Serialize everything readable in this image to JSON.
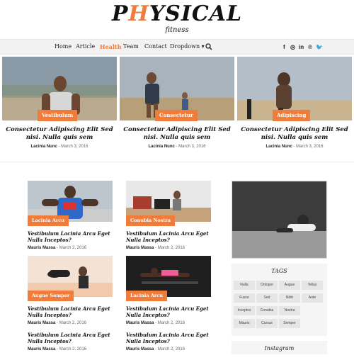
{
  "logo": {
    "main_prefix": "P",
    "main_accent": "H",
    "main_suffix": "YSICAL",
    "sub": "fitness"
  },
  "nav": {
    "items": [
      "Home",
      "Article",
      "Health",
      "Team",
      "Contact",
      "Dropdown ▾"
    ],
    "active": "Health",
    "social": [
      "f",
      "◎",
      "in",
      "℗",
      "🐦"
    ]
  },
  "featured": [
    {
      "tag": "Vestibulum",
      "title": "Consectetur Adipiscing Elit Sed nisi. Nulla quis sem",
      "author": "Lacinia Nunc",
      "date": " - March 3, 2016"
    },
    {
      "tag": "Consectetur",
      "title": "Consectetur Adipiscing Elit Sed nisi. Nulla quis sem",
      "author": "Lacinia Nunc",
      "date": " - March 3, 2016"
    },
    {
      "tag": "Adipiscing",
      "title": "Consectetur Adipiscing Elit Sed nisi. Nulla quis sem",
      "author": "Lacinia Nunc",
      "date": " - March 3, 2016"
    }
  ],
  "posts": [
    {
      "tag": "Lacinia Arcu",
      "title": "Vestibulum Lacinia Arcu Eget Nulla Inceptos?",
      "author": "Mauris Massa",
      "date": " - March 2, 2016"
    },
    {
      "tag": "Conubia Nostra",
      "title": "Vestibulum Lacinia Arcu Eget Nulla Inceptos?",
      "author": "Mauris Massa",
      "date": " - March 2, 2016"
    },
    {
      "tag": "Augue Semper",
      "title": "Vestibulum Lacinia Arcu Eget Nulla Inceptos?",
      "author": "Mauris Massa",
      "date": " - March 2, 2016"
    },
    {
      "tag": "Lacinia Arcu",
      "title": "Vestibulum Lacinia Arcu Eget Nulla Inceptos?",
      "author": "Mauris Massa",
      "date": " - March 2, 2016"
    },
    {
      "tag": "",
      "title": "Vestibulum Lacinia Arcu Eget Nulla Inceptos?",
      "author": "Mauris Massa",
      "date": " - March 2, 2016"
    },
    {
      "tag": "",
      "title": "Vestibulum Lacinia Arcu Eget Nulla Inceptos?",
      "author": "Mauris Massa",
      "date": " - March 2, 2016"
    }
  ],
  "tags": {
    "title": "TAGS",
    "items": [
      "Nulla",
      "Ontoper",
      "Augue",
      "Tellus",
      "Fusce",
      "Sed",
      "Nibh",
      "Ante",
      "Inceptos",
      "Conubia",
      "Nostra",
      "Mauris",
      "Cursus",
      "Semper"
    ]
  },
  "instagram": {
    "title": "Instagram"
  },
  "colors": {
    "accent": "#f07c3c"
  }
}
